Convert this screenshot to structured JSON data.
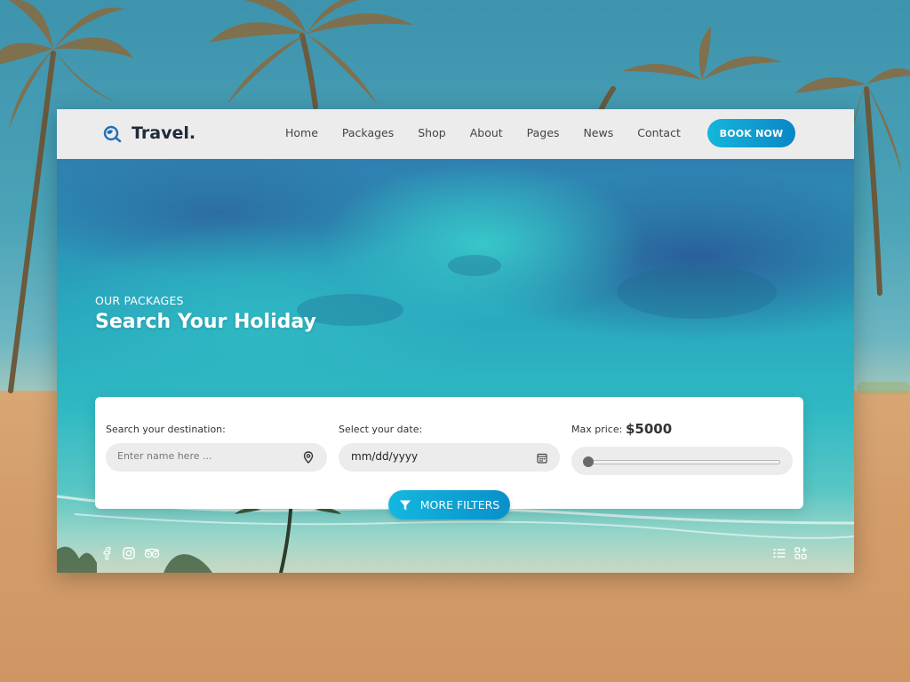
{
  "brand": {
    "name": "Travel.",
    "logo_icon": "globe-search-icon",
    "accent_color": "#0a9fd6"
  },
  "nav": {
    "items": [
      {
        "label": "Home"
      },
      {
        "label": "Packages"
      },
      {
        "label": "Shop"
      },
      {
        "label": "About"
      },
      {
        "label": "Pages"
      },
      {
        "label": "News"
      },
      {
        "label": "Contact"
      }
    ],
    "book_button": "BOOK NOW"
  },
  "hero": {
    "eyebrow": "OUR PACKAGES",
    "title": "Search Your Holiday"
  },
  "search": {
    "destination": {
      "label": "Search your destination:",
      "placeholder": "Enter name here ...",
      "icon": "map-pin-icon"
    },
    "date": {
      "label": "Select your date:",
      "value": "mm/dd/yyyy",
      "icon": "calendar-icon"
    },
    "price": {
      "label": "Max price:",
      "value": "$5000",
      "slider_fraction": 0.0
    },
    "more_filters": "MORE FILTERS",
    "filter_icon": "filter-funnel-icon"
  },
  "footer": {
    "social_icons": [
      "facebook-icon",
      "instagram-icon",
      "tripadvisor-icon"
    ],
    "view_icons": [
      "list-view-icon",
      "grid-view-icon"
    ]
  }
}
